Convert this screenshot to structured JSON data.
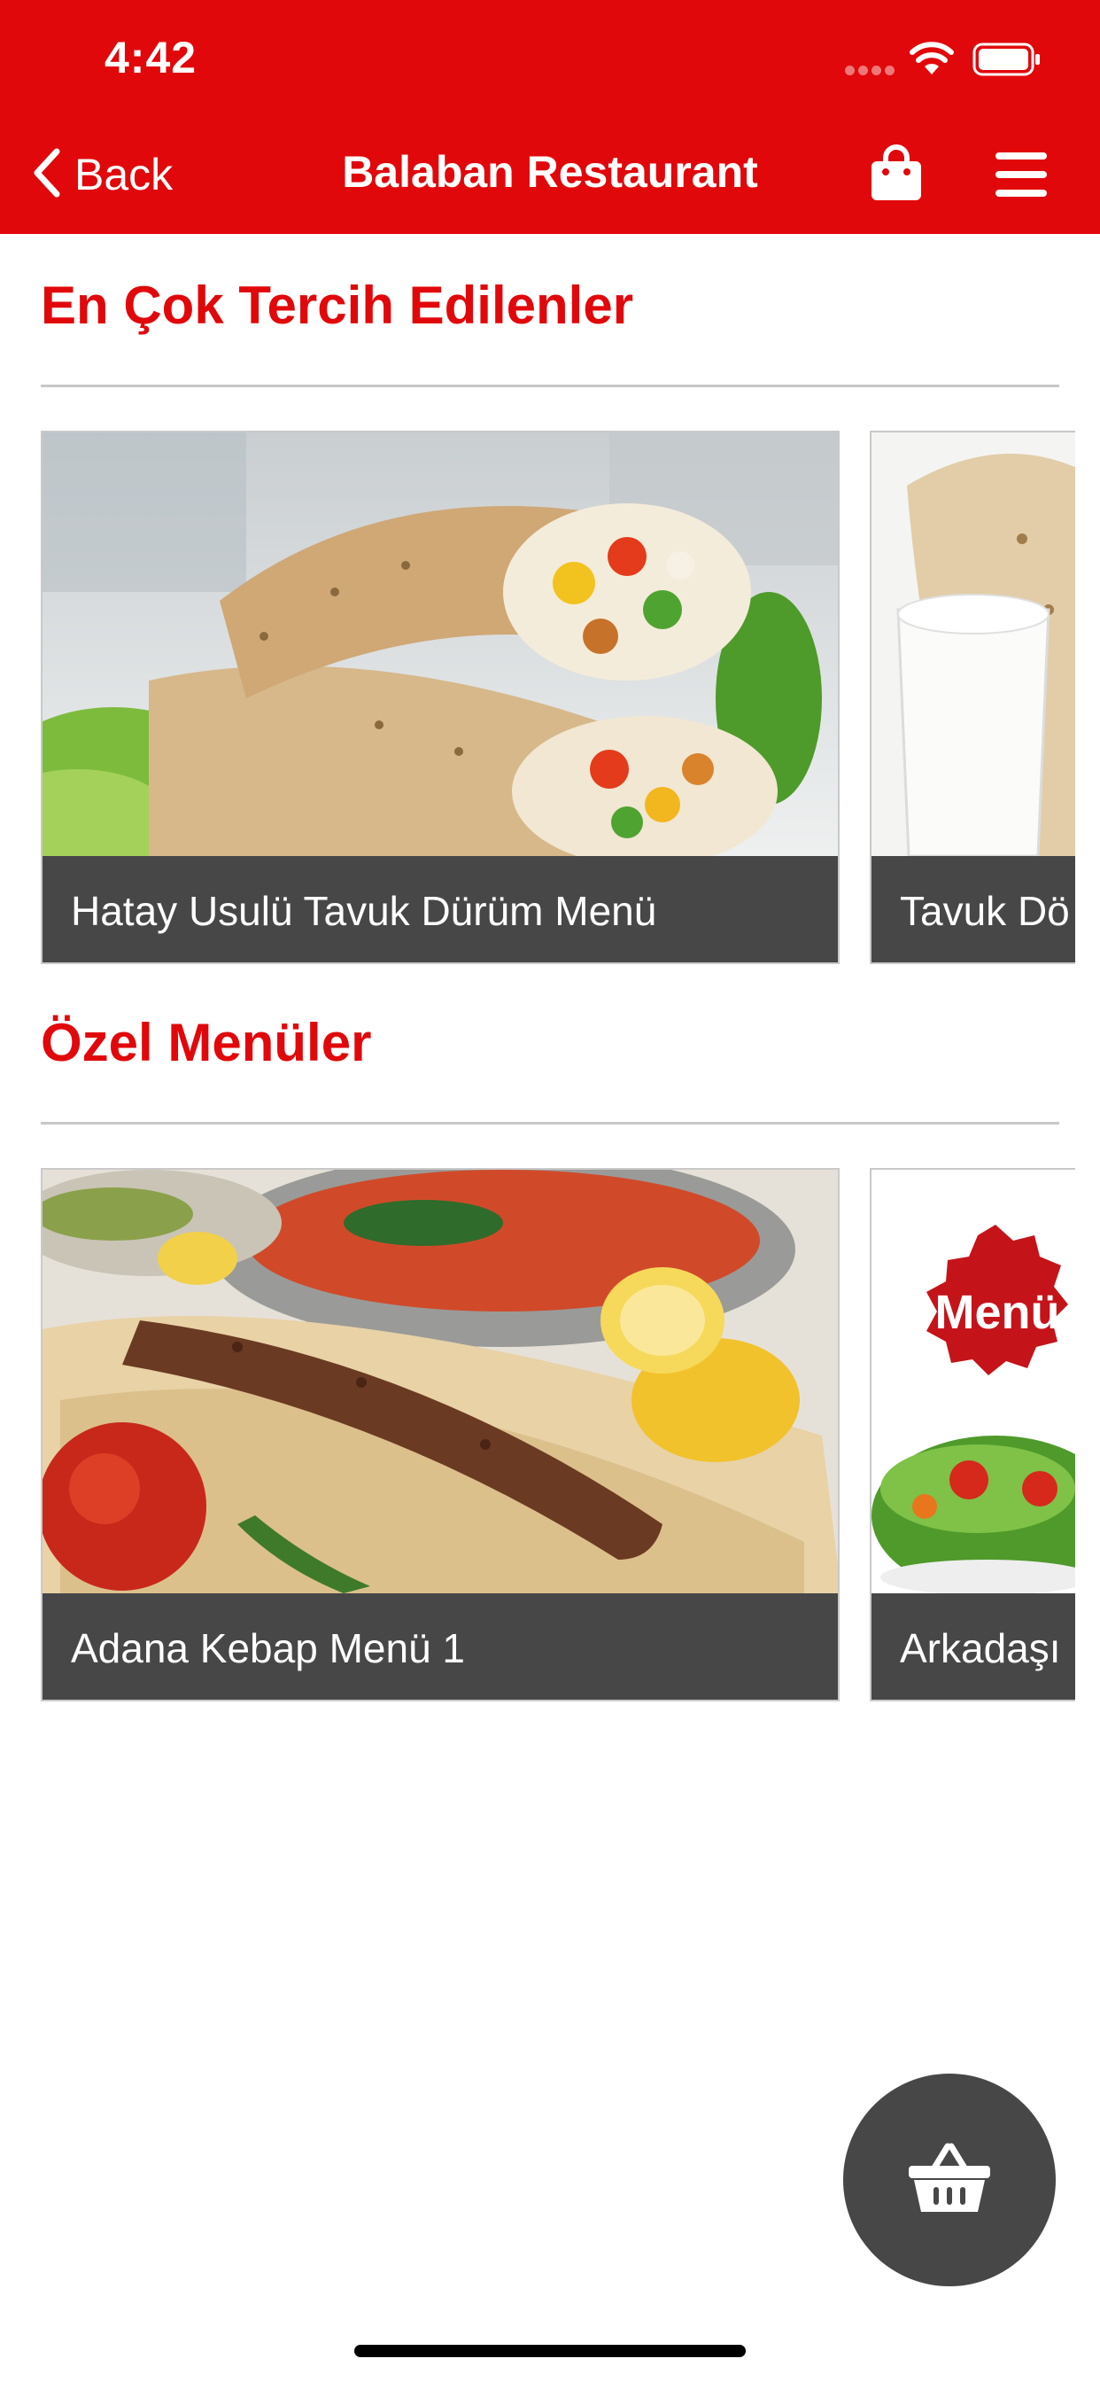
{
  "status_bar": {
    "time": "4:42"
  },
  "nav": {
    "back_label": "Back",
    "title": "Balaban Restaurant",
    "icons": [
      "chevron-left-icon",
      "shopping-bag-icon",
      "hamburger-menu-icon"
    ]
  },
  "sections": [
    {
      "title": "En Çok Tercih Edilenler",
      "items": [
        {
          "caption": "Hatay Usulü Tavuk Dürüm Menü",
          "image": "chicken-durum-wrap-photo"
        },
        {
          "caption": "Tavuk Dö",
          "image": "durum-with-ayran-photo"
        }
      ]
    },
    {
      "title": "Özel Menüler",
      "items": [
        {
          "caption": "Adana Kebap Menü 1",
          "image": "adana-kebab-plate-photo"
        },
        {
          "caption": "Arkadaşı",
          "image": "menu-badge-salad-photo",
          "badge": "Menü"
        }
      ]
    }
  ],
  "fab": {
    "icon": "shopping-basket-icon"
  },
  "colors": {
    "brand": "#e1080b",
    "caption_bg": "#474748",
    "divider": "#c8c8c8"
  }
}
